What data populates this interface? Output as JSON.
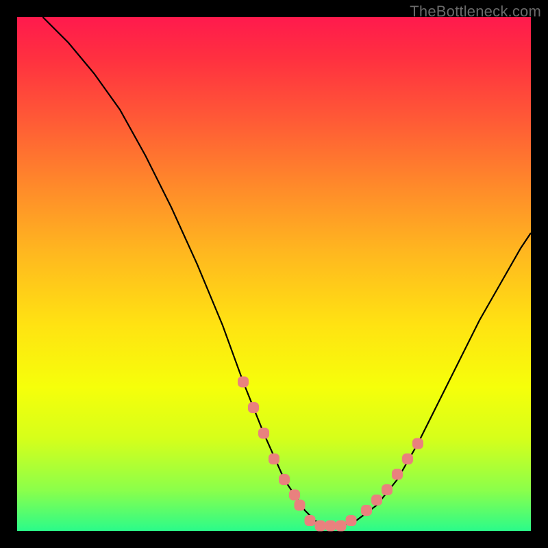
{
  "watermark": "TheBottleneck.com",
  "colors": {
    "line": "#000000",
    "marker_fill": "#e9817e",
    "marker_stroke": "#c9605e",
    "background": "#000000"
  },
  "chart_data": {
    "type": "line",
    "title": "",
    "xlabel": "",
    "ylabel": "",
    "xlim": [
      0,
      100
    ],
    "ylim": [
      0,
      100
    ],
    "grid": false,
    "legend": false,
    "series": [
      {
        "name": "curve",
        "x": [
          5,
          10,
          15,
          20,
          25,
          30,
          35,
          40,
          44,
          48,
          52,
          56,
          58,
          60,
          63,
          66,
          70,
          74,
          78,
          82,
          86,
          90,
          94,
          98,
          100
        ],
        "y": [
          100,
          95,
          89,
          82,
          73,
          63,
          52,
          40,
          29,
          19,
          10,
          4,
          2,
          1,
          1,
          2,
          5,
          10,
          17,
          25,
          33,
          41,
          48,
          55,
          58
        ]
      }
    ],
    "markers": {
      "left_cluster": {
        "x": [
          44,
          46,
          48,
          50,
          52,
          54,
          55
        ],
        "y": [
          29,
          24,
          19,
          14,
          10,
          7,
          5
        ]
      },
      "bottom_cluster": {
        "x": [
          57,
          59,
          61,
          63,
          65
        ],
        "y": [
          2,
          1,
          1,
          1,
          2
        ]
      },
      "right_cluster": {
        "x": [
          68,
          70,
          72,
          74,
          76,
          78
        ],
        "y": [
          4,
          6,
          8,
          11,
          14,
          17
        ]
      }
    }
  }
}
